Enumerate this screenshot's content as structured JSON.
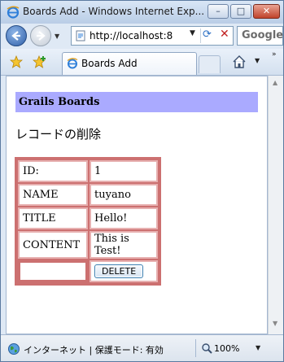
{
  "window": {
    "title": "Boards Add - Windows Internet Exp...",
    "controls": {
      "minimize": "–",
      "maximize": "□",
      "close": "✕"
    }
  },
  "toolbar": {
    "url": "http://localhost:8",
    "search_placeholder": "Google",
    "dropdown_glyph": "▼",
    "refresh_glyph": "⟳",
    "stop_glyph": "✕",
    "chevrons": "»"
  },
  "tabs": [
    {
      "label": "Boards Add",
      "icon": "ie-page-icon",
      "active": true
    }
  ],
  "page": {
    "site_title": "Grails Boards",
    "heading": "レコードの削除",
    "record": [
      {
        "key": "ID:",
        "value": "1"
      },
      {
        "key": "NAME",
        "value": "tuyano"
      },
      {
        "key": "TITLE",
        "value": "Hello!"
      },
      {
        "key": "CONTENT",
        "value": "This is Test!"
      }
    ],
    "delete_button": "DELETE"
  },
  "status": {
    "zone": "インターネット | 保護モード: 有効",
    "zoom": "100%"
  },
  "colors": {
    "header_bar": "#aaaaff",
    "table_border": "#cc7070",
    "cell_border": "#e7b0b0"
  }
}
